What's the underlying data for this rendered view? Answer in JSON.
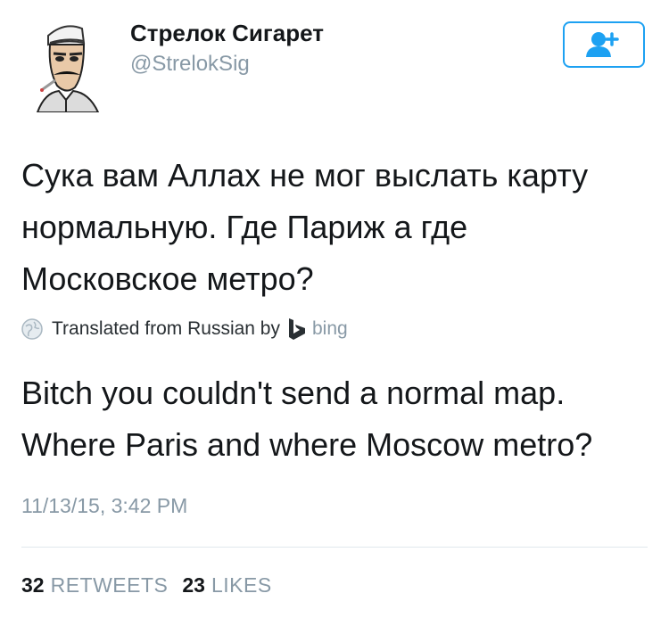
{
  "user": {
    "display_name": "Стрелок Сигарет",
    "handle": "@StrelokSig",
    "avatar_icon": "sketch-portrait-avatar"
  },
  "follow_button": {
    "icon": "add-user-icon",
    "color": "#1da1f2"
  },
  "tweet": {
    "text": "Сука вам Аллах не мог выслать карту нормальную. Где Париж а где Московское метро?",
    "translation_label": "Translated from Russian by",
    "translation_provider": "bing",
    "translated_text": "Bitch you couldn't send a normal map. Where Paris and where Moscow metro?",
    "timestamp": "11/13/15, 3:42 PM"
  },
  "stats": {
    "retweets_count": "32",
    "retweets_label": "RETWEETS",
    "likes_count": "23",
    "likes_label": "LIKES"
  }
}
